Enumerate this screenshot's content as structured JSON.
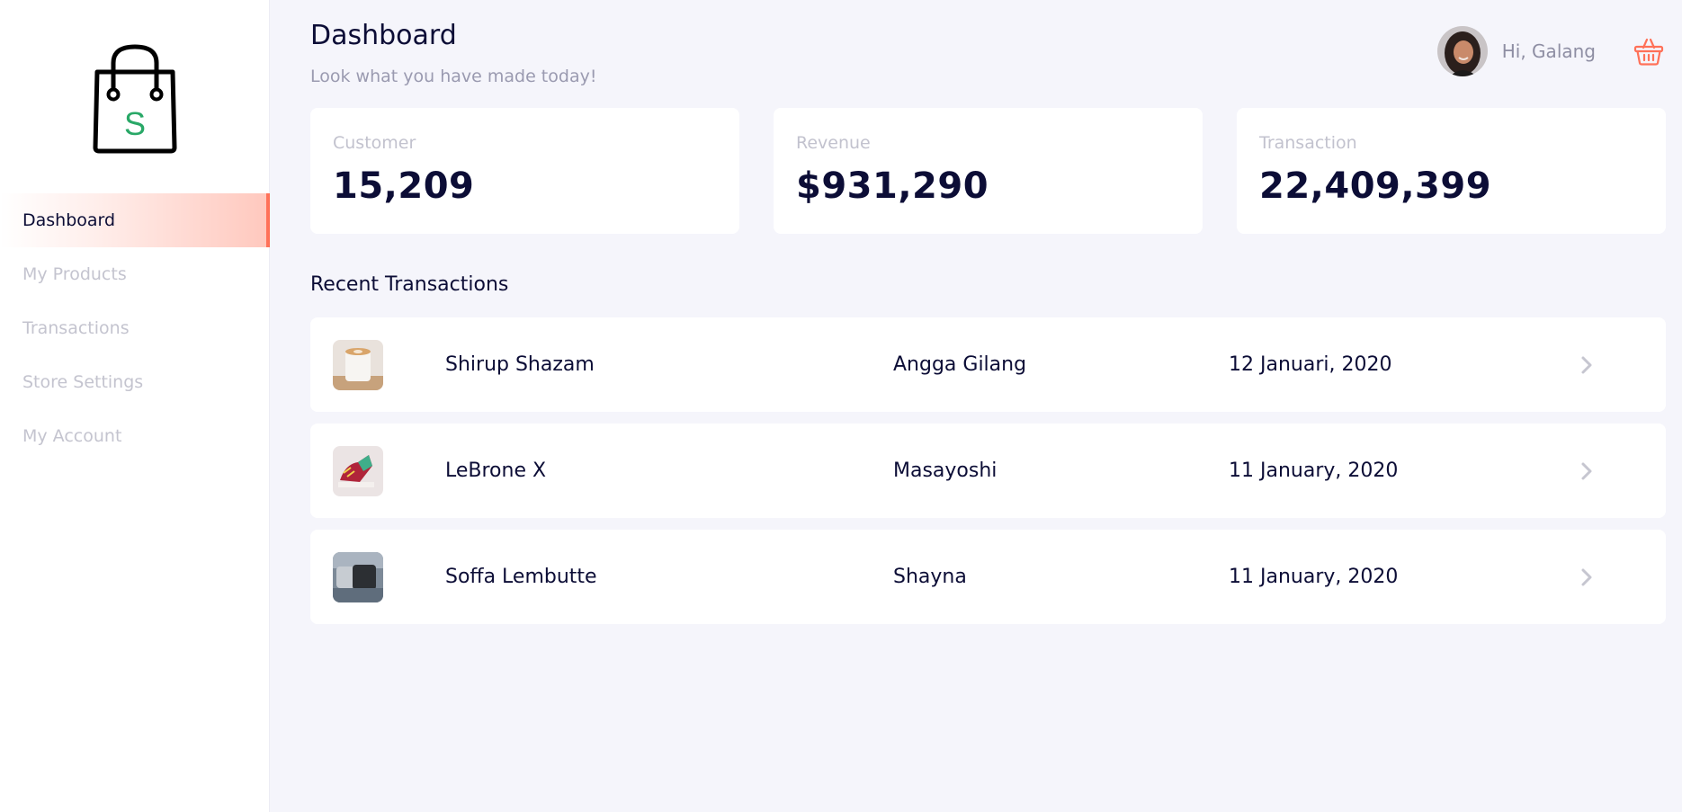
{
  "sidebar": {
    "logo_letter": "S",
    "items": [
      {
        "label": "Dashboard",
        "active": true
      },
      {
        "label": "My Products",
        "active": false
      },
      {
        "label": "Transactions",
        "active": false
      },
      {
        "label": "Store Settings",
        "active": false
      },
      {
        "label": "My Account",
        "active": false
      }
    ]
  },
  "header": {
    "title": "Dashboard",
    "subtitle": "Look what you have made today!",
    "greeting": "Hi, Galang",
    "cart_icon": "basket-icon"
  },
  "stats": [
    {
      "label": "Customer",
      "value": "15,209"
    },
    {
      "label": "Revenue",
      "value": "$931,290"
    },
    {
      "label": "Transaction",
      "value": "22,409,399"
    }
  ],
  "recent": {
    "title": "Recent Transactions",
    "rows": [
      {
        "product": "Shirup Shazam",
        "customer": "Angga Gilang",
        "date": "12 Januari, 2020",
        "thumb": "coffee-cup-thumbnail"
      },
      {
        "product": "LeBrone X",
        "customer": "Masayoshi",
        "date": "11 January, 2020",
        "thumb": "sneaker-thumbnail"
      },
      {
        "product": "Soffa Lembutte",
        "customer": "Shayna",
        "date": "11 January, 2020",
        "thumb": "sofa-thumbnail"
      }
    ]
  },
  "colors": {
    "accent": "#ff7158",
    "navy": "#0c0d36",
    "muted": "#c4c4cf",
    "background": "#f5f5fb",
    "logo_green": "#29a867"
  }
}
